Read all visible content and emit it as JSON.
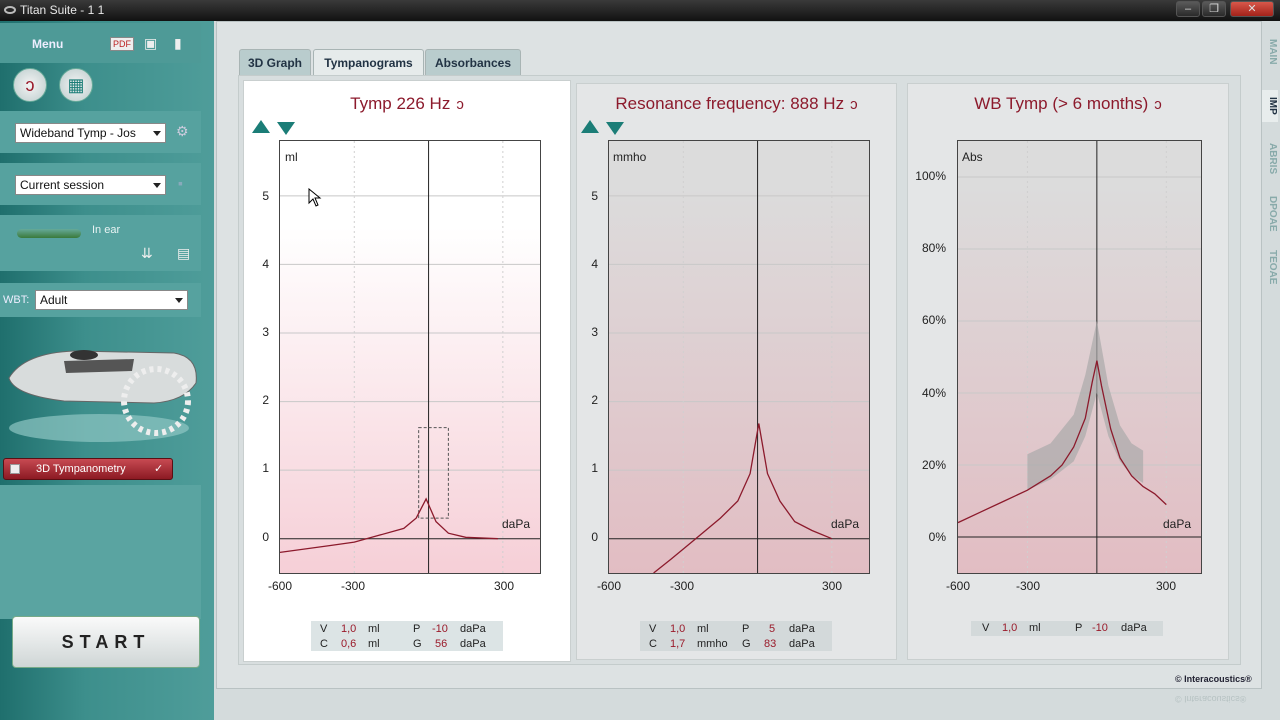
{
  "window": {
    "title": "Titan Suite - 1 1",
    "min": "–",
    "max": "❐",
    "close": "✕"
  },
  "sidebar": {
    "menu_label": "Menu",
    "protocol": "Wideband Tymp - Jos",
    "session": "Current session",
    "in_ear": "In ear",
    "wbt_label": "WBT:",
    "wbt_value": "Adult",
    "test_item": "3D Tympanometry",
    "tick": "✓",
    "start": "START"
  },
  "tabs": [
    {
      "label": "3D Graph"
    },
    {
      "label": "Tympanograms"
    },
    {
      "label": "Absorbances"
    }
  ],
  "active_tab": "Tympanograms",
  "side_tabs": [
    "MAIN",
    "IMP",
    "ABRIS",
    "DPOAE",
    "TEOAE"
  ],
  "colors": {
    "accent": "#8c1a2c",
    "teal": "#1b7d77",
    "curve": "#8c1a2c"
  },
  "panels": {
    "tymp": {
      "title": "Tymp 226 Hz",
      "y_unit": "ml",
      "x_unit": "daPa",
      "yticks": [
        "5",
        "4",
        "3",
        "2",
        "1",
        "0"
      ],
      "xticks": [
        "-600",
        "-300",
        "300"
      ],
      "table": {
        "r1": [
          "V",
          "1,0",
          "ml",
          "P",
          "-10",
          "daPa"
        ],
        "r2": [
          "C",
          "0,6",
          "ml",
          "G",
          "56",
          "daPa"
        ]
      }
    },
    "res": {
      "title": "Resonance frequency: 888 Hz",
      "y_unit": "mmho",
      "x_unit": "daPa",
      "yticks": [
        "5",
        "4",
        "3",
        "2",
        "1",
        "0"
      ],
      "xticks": [
        "-600",
        "-300",
        "300"
      ],
      "table": {
        "r1": [
          "V",
          "1,0",
          "ml",
          "P",
          "5",
          "daPa"
        ],
        "r2": [
          "C",
          "1,7",
          "mmho",
          "G",
          "83",
          "daPa"
        ]
      }
    },
    "wb": {
      "title": "WB Tymp (> 6 months)",
      "y_unit": "Abs",
      "x_unit": "daPa",
      "yticks": [
        "100%",
        "80%",
        "60%",
        "40%",
        "20%",
        "0%"
      ],
      "xticks": [
        "-600",
        "-300",
        "300"
      ],
      "table": {
        "r1": [
          "V",
          "1,0",
          "ml",
          "P",
          "-10",
          "daPa"
        ]
      }
    }
  },
  "chart_data": [
    {
      "type": "line",
      "title": "Tymp 226 Hz",
      "xlabel": "daPa",
      "ylabel": "ml",
      "xlim": [
        -600,
        450
      ],
      "ylim": [
        -0.5,
        5.8
      ],
      "series": [
        {
          "x": [
            -600,
            -400,
            -300,
            -200,
            -100,
            -50,
            -10,
            30,
            80,
            150,
            280
          ],
          "values": [
            -0.2,
            -0.1,
            -0.05,
            0.05,
            0.15,
            0.3,
            0.58,
            0.25,
            0.08,
            0.02,
            0.0
          ]
        }
      ]
    },
    {
      "type": "line",
      "title": "Resonance frequency: 888 Hz",
      "xlabel": "daPa",
      "ylabel": "mmho",
      "xlim": [
        -600,
        450
      ],
      "ylim": [
        -0.5,
        5.8
      ],
      "series": [
        {
          "x": [
            -420,
            -350,
            -250,
            -150,
            -80,
            -30,
            5,
            40,
            90,
            150,
            220,
            300
          ],
          "values": [
            -0.5,
            -0.3,
            0.0,
            0.3,
            0.55,
            0.95,
            1.68,
            0.95,
            0.55,
            0.25,
            0.12,
            0.0
          ]
        }
      ]
    },
    {
      "type": "line",
      "title": "WB Tymp (> 6 months)",
      "xlabel": "daPa",
      "ylabel": "Abs",
      "xlim": [
        -600,
        450
      ],
      "ylim": [
        -0.1,
        1.1
      ],
      "series": [
        {
          "x": [
            -600,
            -500,
            -400,
            -300,
            -200,
            -150,
            -100,
            -50,
            -20,
            0,
            20,
            60,
            100,
            150,
            200,
            250,
            300
          ],
          "values": [
            0.04,
            0.07,
            0.1,
            0.13,
            0.17,
            0.2,
            0.25,
            0.33,
            0.43,
            0.49,
            0.42,
            0.3,
            0.22,
            0.17,
            0.14,
            0.12,
            0.09
          ]
        }
      ]
    }
  ]
}
